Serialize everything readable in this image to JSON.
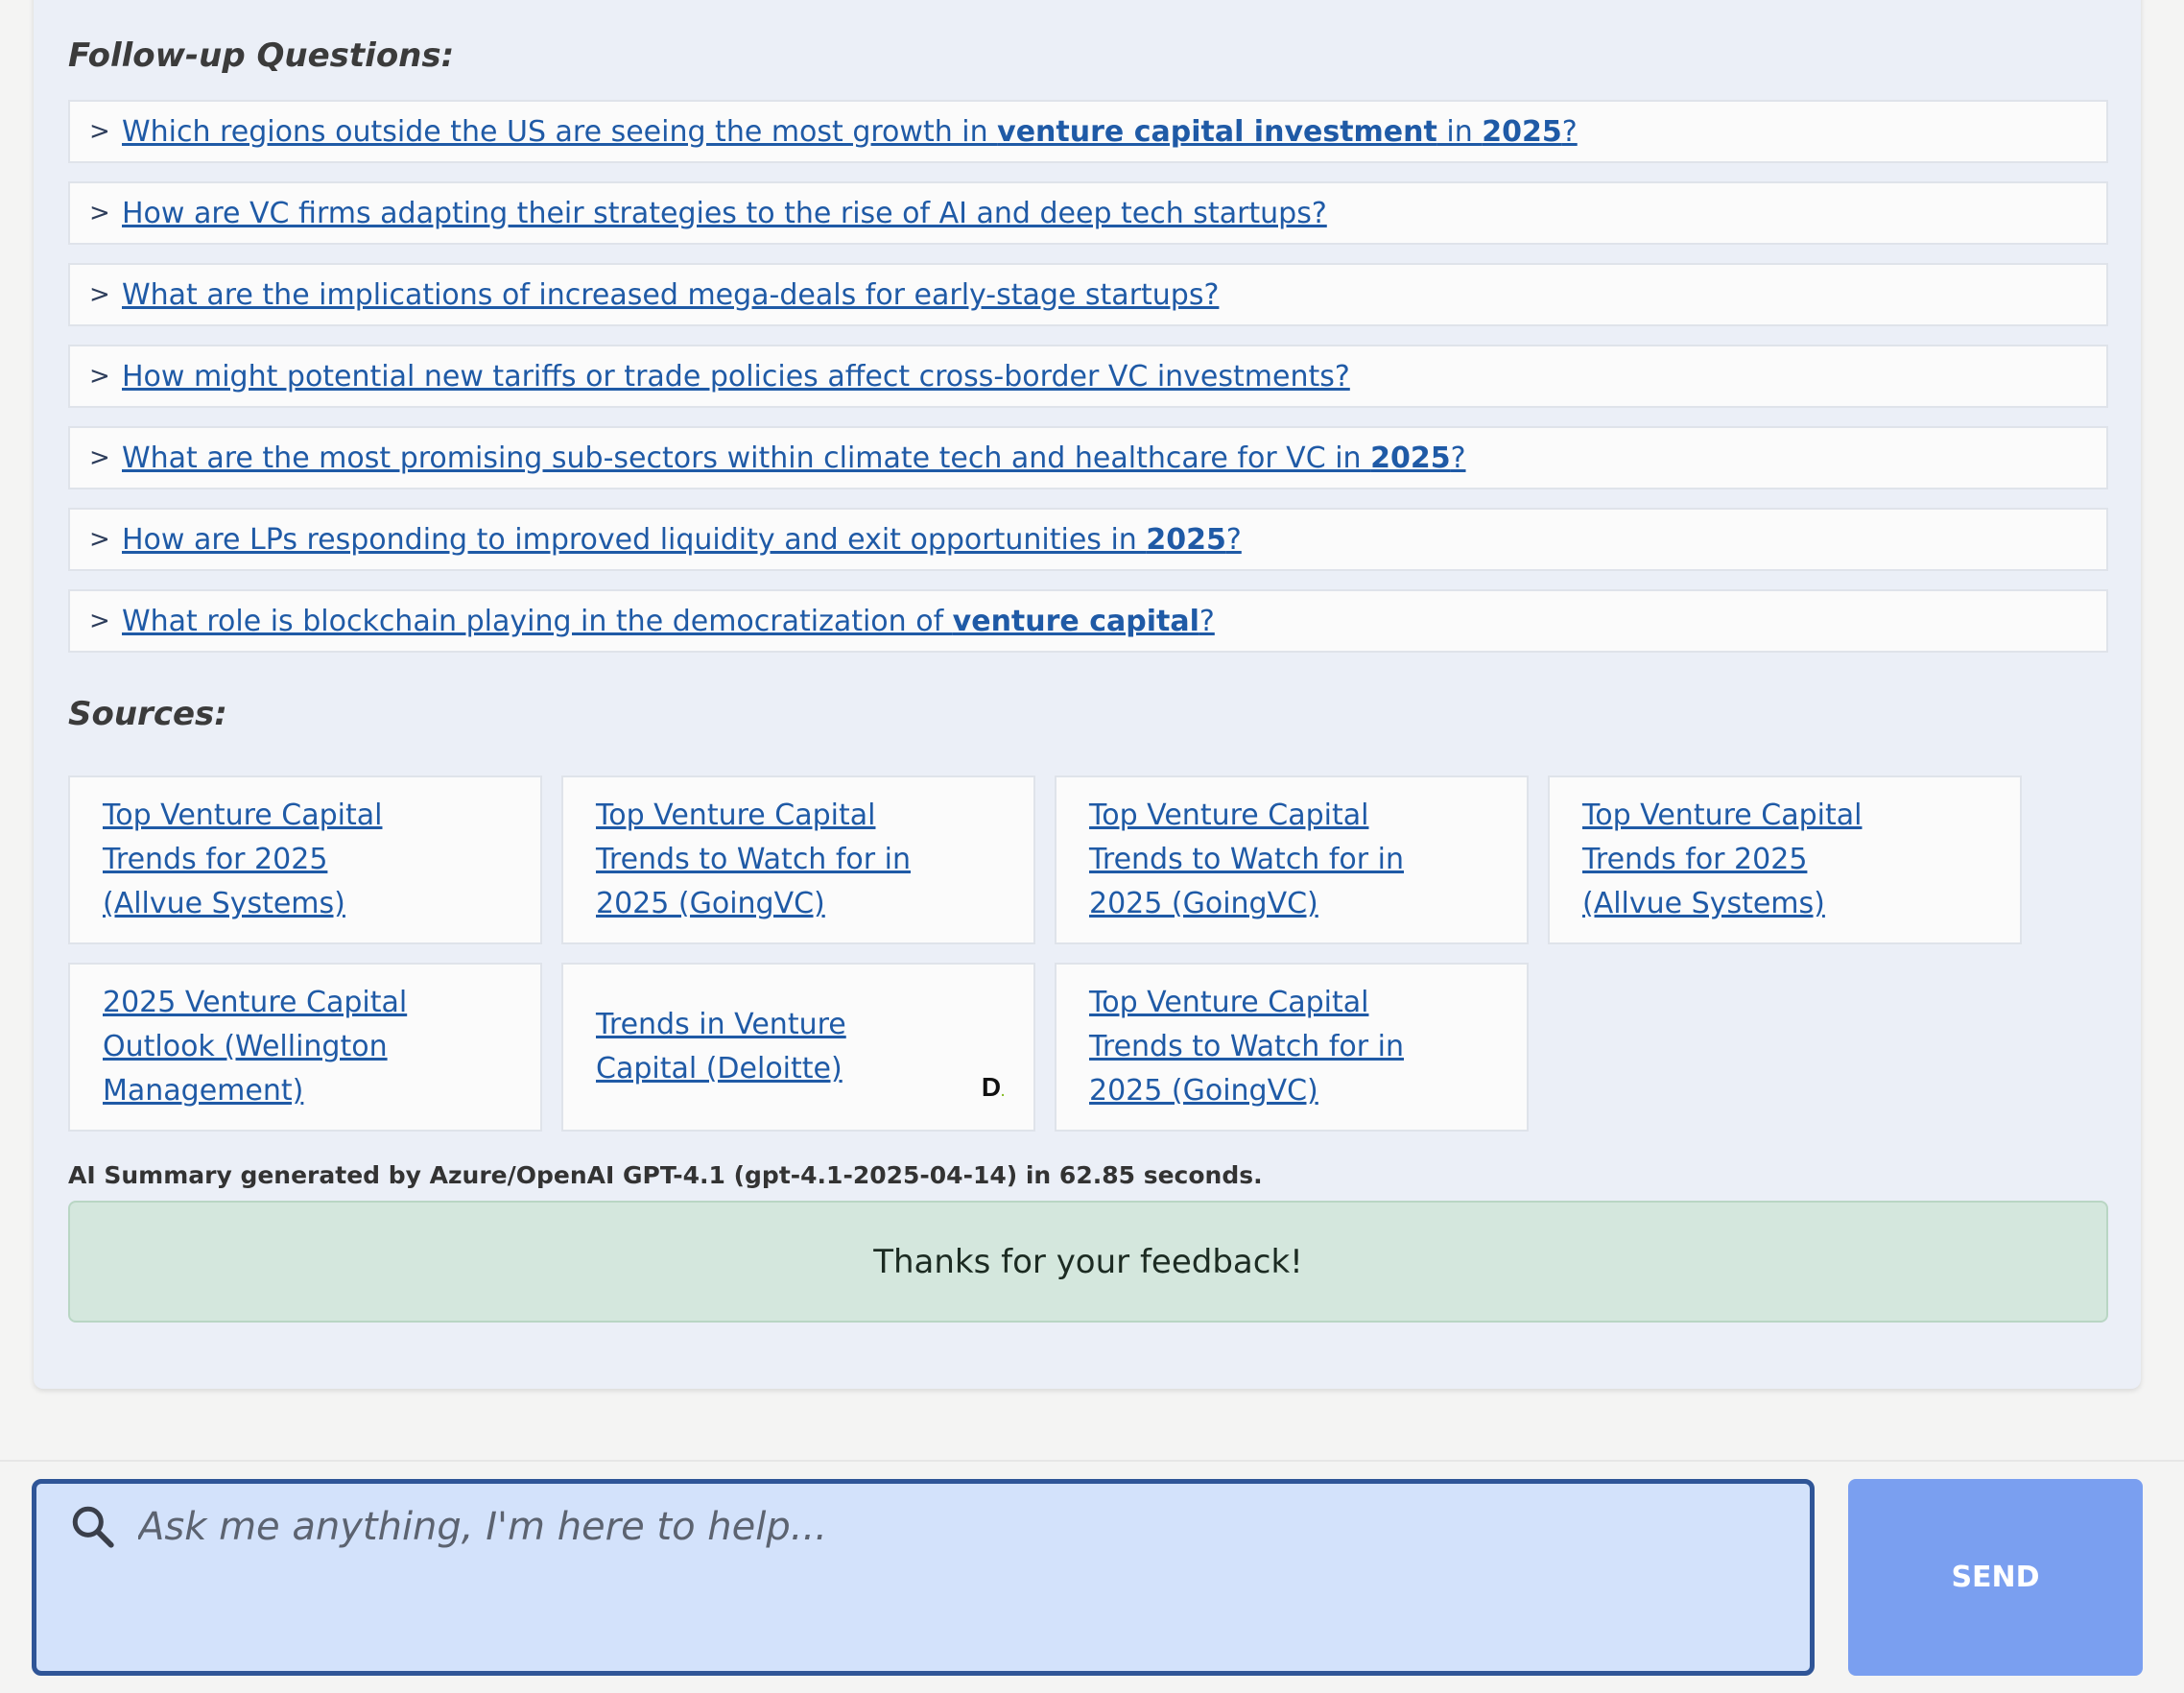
{
  "followup": {
    "heading": "Follow-up Questions:",
    "arrow": ">",
    "items": [
      {
        "parts": [
          {
            "t": "Which regions outside the US are seeing the most growth in "
          },
          {
            "t": "venture capital investment",
            "b": true
          },
          {
            "t": " in "
          },
          {
            "t": "2025",
            "b": true
          },
          {
            "t": "?"
          }
        ]
      },
      {
        "parts": [
          {
            "t": "How are VC firms adapting their strategies to the rise of AI and deep tech startups?"
          }
        ]
      },
      {
        "parts": [
          {
            "t": "What are the implications of increased mega-deals for early-stage startups?"
          }
        ]
      },
      {
        "parts": [
          {
            "t": "How might potential new tariffs or trade policies affect cross-border VC investments?"
          }
        ]
      },
      {
        "parts": [
          {
            "t": "What are the most promising sub-sectors within climate tech and healthcare for VC in "
          },
          {
            "t": "2025",
            "b": true
          },
          {
            "t": "?"
          }
        ]
      },
      {
        "parts": [
          {
            "t": "How are LPs responding to improved liquidity and exit opportunities in "
          },
          {
            "t": "2025",
            "b": true
          },
          {
            "t": "?"
          }
        ]
      },
      {
        "parts": [
          {
            "t": "What role is blockchain playing in the democratization of "
          },
          {
            "t": "venture capital",
            "b": true
          },
          {
            "t": "?"
          }
        ]
      }
    ]
  },
  "sources": {
    "heading": "Sources:",
    "items": [
      {
        "label": "Top Venture Capital Trends for 2025 (Allvue Systems)"
      },
      {
        "label": "Top Venture Capital Trends to Watch for in 2025 (GoingVC)"
      },
      {
        "label": "Top Venture Capital Trends to Watch for in 2025 (GoingVC)"
      },
      {
        "label": "Top Venture Capital Trends for 2025 (Allvue Systems)"
      },
      {
        "label": "2025 Venture Capital Outlook (Wellington Management)"
      },
      {
        "label": "Trends in Venture Capital (Deloitte)",
        "logo": "D",
        "logo_dot": "."
      },
      {
        "label": "Top Venture Capital Trends to Watch for in 2025 (GoingVC)"
      }
    ]
  },
  "ai_summary": "AI Summary generated by Azure/OpenAI GPT-4.1 (gpt-4.1-2025-04-14) in 62.85 seconds.",
  "feedback_message": "Thanks for your feedback!",
  "search": {
    "placeholder": "Ask me anything, I'm here to help...",
    "icon": "search-icon"
  },
  "send_label": "SEND"
}
